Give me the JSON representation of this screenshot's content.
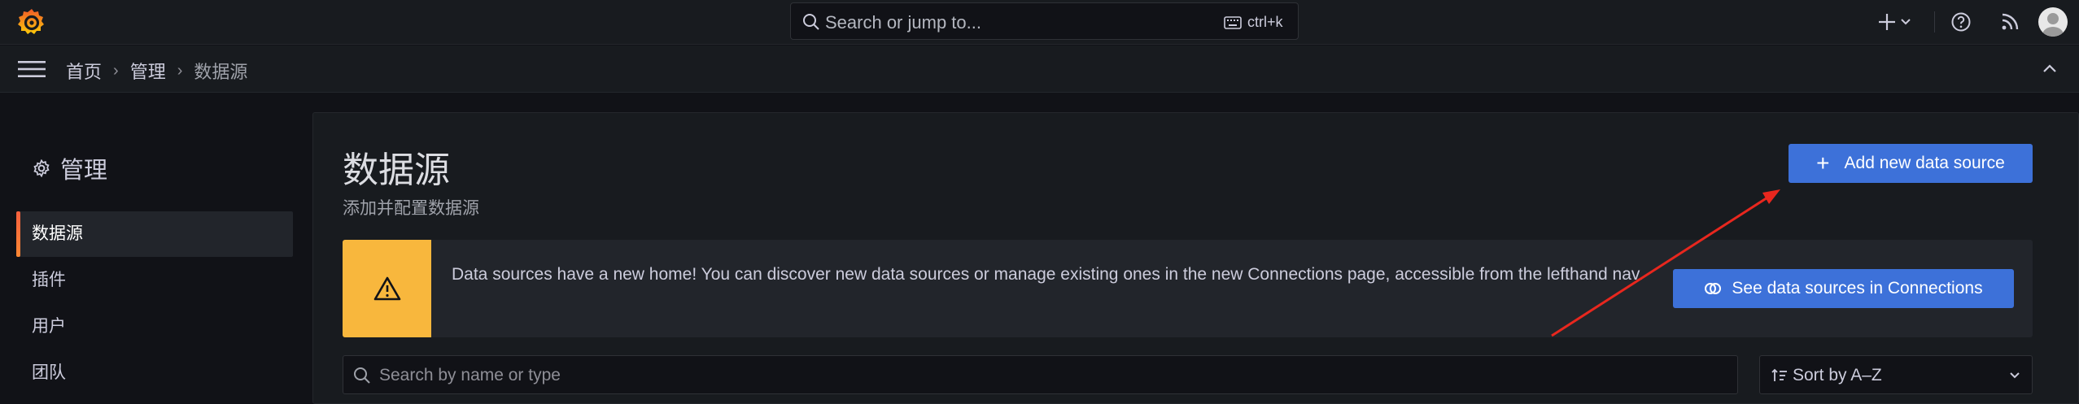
{
  "topbar": {
    "search_placeholder": "Search or jump to...",
    "search_shortcut": "ctrl+k",
    "icons": [
      "grafana-logo-icon",
      "search-icon",
      "keyboard-icon",
      "plus-icon",
      "chevron-down-icon",
      "help-icon",
      "rss-icon",
      "avatar"
    ]
  },
  "breadcrumbs": {
    "items": [
      "首页",
      "管理",
      "数据源"
    ]
  },
  "sidebar": {
    "title": "管理",
    "items": [
      {
        "label": "数据源",
        "active": true
      },
      {
        "label": "插件",
        "active": false
      },
      {
        "label": "用户",
        "active": false
      },
      {
        "label": "团队",
        "active": false
      }
    ]
  },
  "main": {
    "title": "数据源",
    "subtitle": "添加并配置数据源",
    "add_button": "Add new data source",
    "alert": {
      "text": "Data sources have a new home! You can discover new data sources or manage existing ones in the new Connections page, accessible from the lefthand nav.",
      "button": "See data sources in Connections"
    },
    "filter_placeholder": "Search by name or type",
    "sort_value": "Sort by A–Z"
  },
  "colors": {
    "primary": "#3d71d9",
    "warning": "#f8b73d",
    "annotation": "#e8271e",
    "active_accent": "#f55f3e"
  }
}
